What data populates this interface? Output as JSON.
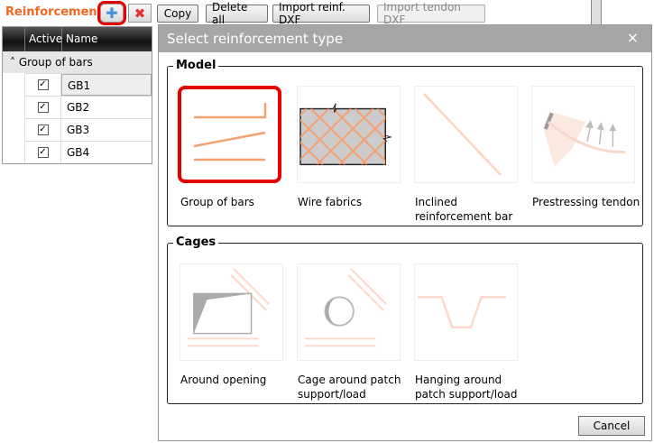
{
  "panel": {
    "title": "Reinforcement"
  },
  "toolbar": {
    "add_icon": "plus-icon",
    "delete_icon": "red-x-icon",
    "copy": "Copy",
    "delete_all": "Delete all",
    "import_reinf": "Import reinf. DXF",
    "import_tendon": "Import tendon DXF"
  },
  "table": {
    "columns": [
      "",
      "Active",
      "Name"
    ],
    "group": "Group of bars",
    "rows": [
      {
        "active": true,
        "name": "GB1"
      },
      {
        "active": true,
        "name": "GB2"
      },
      {
        "active": true,
        "name": "GB3"
      },
      {
        "active": true,
        "name": "GB4"
      }
    ]
  },
  "dialog": {
    "title": "Select reinforcement type",
    "close": "×",
    "model": {
      "label": "Model",
      "items": [
        "Group of bars",
        "Wire fabrics",
        "Inclined reinforcement bar",
        "Prestressing tendon"
      ]
    },
    "cages": {
      "label": "Cages",
      "items": [
        "Around opening",
        "Cage around patch support/load",
        "Hanging around patch support/load"
      ]
    },
    "cancel": "Cancel"
  },
  "colors": {
    "accent": "#f26522",
    "highlight": "#e60000",
    "bar": "#f4a070"
  }
}
